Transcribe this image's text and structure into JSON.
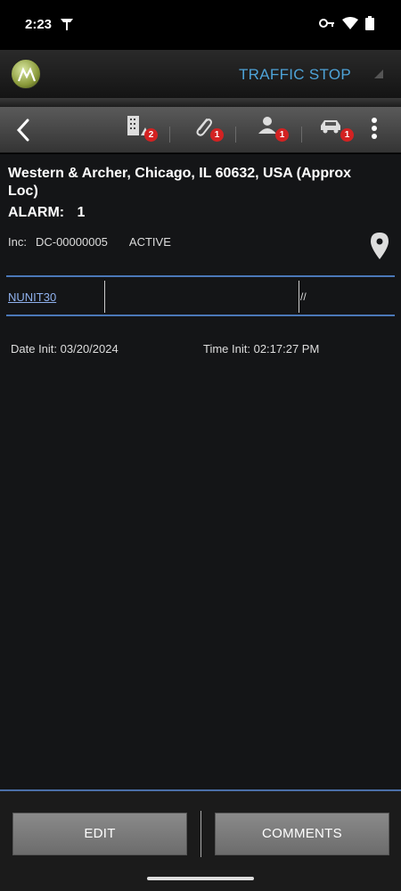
{
  "status_bar": {
    "time": "2:23",
    "left_icon": "signal-antenna-icon",
    "right_icons": [
      "key-icon",
      "wifi-icon",
      "battery-icon"
    ]
  },
  "header": {
    "logo": "motorola-logo",
    "title": "TRAFFIC STOP"
  },
  "toolbar": {
    "back_icon": "chevron-left-icon",
    "items": [
      {
        "icon": "building-alert-icon",
        "badge": "2"
      },
      {
        "icon": "paperclip-icon",
        "badge": "1"
      },
      {
        "icon": "person-icon",
        "badge": "1"
      },
      {
        "icon": "car-icon",
        "badge": "1"
      }
    ],
    "more_icon": "kebab-menu-icon"
  },
  "incident": {
    "address": "Western & Archer, Chicago, IL 60632, USA (Approx Loc)",
    "alarm_label": "ALARM:",
    "alarm_value": "1",
    "inc_label": "Inc:",
    "inc_id": "DC-00000005",
    "status": "ACTIVE",
    "location_icon": "map-pin-icon"
  },
  "unit": {
    "name": "NUNIT30",
    "middle": "",
    "slashes": "//"
  },
  "dates": {
    "date_init": "Date Init: 03/20/2024",
    "time_init": "Time Init: 02:17:27 PM"
  },
  "actions": {
    "edit": "EDIT",
    "comments": "COMMENTS"
  },
  "colors": {
    "accent_title": "#4ea3d8",
    "link": "#8fb1ee",
    "badge": "#d32222",
    "separator_line": "#4b78b8"
  }
}
